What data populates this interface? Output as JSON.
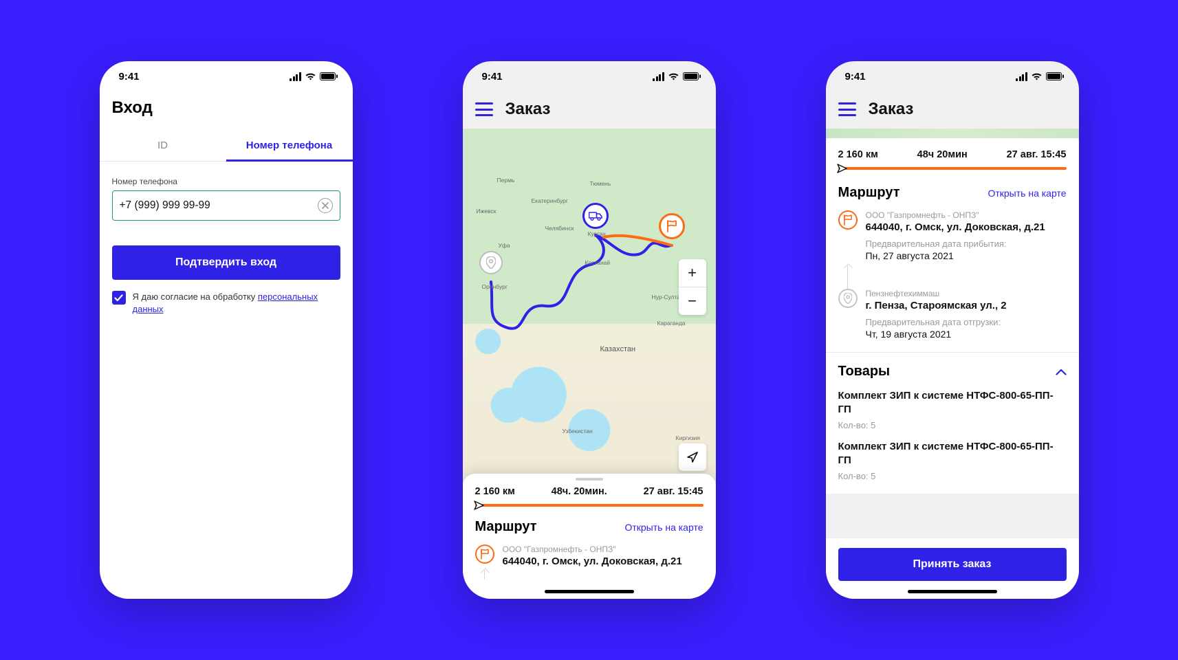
{
  "status": {
    "time": "9:41"
  },
  "screen1": {
    "title": "Вход",
    "tabs": {
      "id": "ID",
      "phone": "Номер телефона"
    },
    "phone_label": "Номер телефона",
    "phone_value": "+7 (999) 999 99-99",
    "confirm_button": "Подтвердить вход",
    "consent_prefix": "Я даю согласие на обработку ",
    "consent_link": "персональных данных"
  },
  "screen2": {
    "header": "Заказ",
    "metrics": {
      "distance": "2 160 км",
      "duration": "48ч. 20мин.",
      "arrival": "27 авг. 15:45"
    },
    "route_title": "Маршрут",
    "open_map": "Открыть на карте",
    "stopA": {
      "company": "ООО \"Газпромнефть - ОНПЗ\"",
      "address": "644040, г. Омск, ул. Доковская, д.21"
    },
    "map_labels": {
      "perm": "Пермь",
      "izhevsk": "Ижевск",
      "ekb": "Екатеринбург",
      "tyumen": "Тюмень",
      "chel": "Челябинск",
      "kurgan": "Курган",
      "ufa": "Уфа",
      "orenburg": "Оренбург",
      "kostanay": "Костанай",
      "nursultan": "Нур-Султан",
      "karaganda": "Караганда",
      "kazakhstan": "Казахстан",
      "uzbekistan": "Узбекистан",
      "kirg": "Киргизия"
    }
  },
  "screen3": {
    "header": "Заказ",
    "metrics": {
      "distance": "2 160 км",
      "duration": "48ч 20мин",
      "arrival": "27 авг. 15:45"
    },
    "route_title": "Маршрут",
    "open_map": "Открыть на карте",
    "stopA": {
      "company": "ООО \"Газпромнефть - ОНПЗ\"",
      "address": "644040, г. Омск, ул. Доковская, д.21",
      "eta_label": "Предварительная дата прибытия:",
      "eta_value": "Пн, 27 августа 2021"
    },
    "stopB": {
      "company": "Пензнефтехиммаш",
      "address": "г. Пенза, Староямская ул., 2",
      "ship_label": "Предварительная дата отгрузки:",
      "ship_value": "Чт, 19 августа 2021"
    },
    "goods_title": "Товары",
    "goods": [
      {
        "name": "Комплект ЗИП к системе НТФС-800-65-ПП-ГП",
        "qty": "Кол-во: 5"
      },
      {
        "name": "Комплект ЗИП к системе НТФС-800-65-ПП-ГП",
        "qty": "Кол-во: 5"
      }
    ],
    "accept_button": "Принять заказ"
  }
}
